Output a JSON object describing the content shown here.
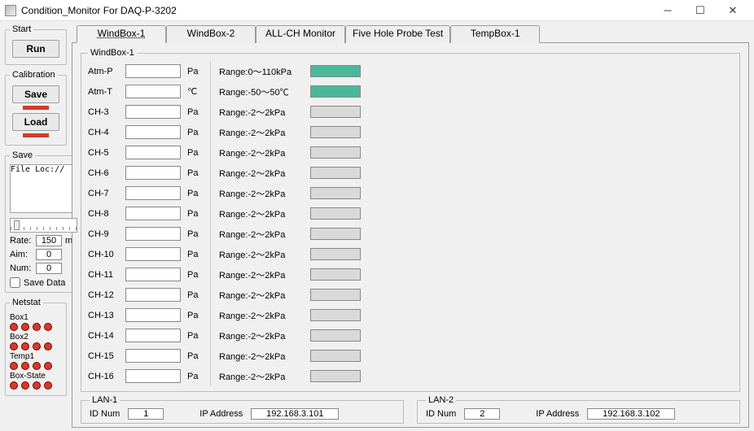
{
  "window": {
    "title": "Condition_Monitor For DAQ-P-3202"
  },
  "sidebar": {
    "start": {
      "legend": "Start",
      "run": "Run"
    },
    "calibration": {
      "legend": "Calibration",
      "save": "Save",
      "load": "Load"
    },
    "save": {
      "legend": "Save",
      "file_loc_text": "File Loc://",
      "rate_label": "Rate:",
      "rate_value": "150",
      "rate_unit": "ms",
      "aim_label": "Aim:",
      "aim_value": "0",
      "num_label": "Num:",
      "num_value": "0",
      "save_data_label": "Save Data"
    },
    "netstat": {
      "legend": "Netstat",
      "rows": [
        {
          "label": "Box1",
          "count": 4
        },
        {
          "label": "Box2",
          "count": 4
        },
        {
          "label": "Temp1",
          "count": 4
        },
        {
          "label": "Box-State",
          "count": 4
        }
      ]
    }
  },
  "tabs": [
    {
      "label": "WindBox-1"
    },
    {
      "label": "WindBox-2"
    },
    {
      "label": "ALL-CH Monitor"
    },
    {
      "label": "Five Hole Probe Test"
    },
    {
      "label": "TempBox-1"
    }
  ],
  "active_tab": 0,
  "windbox": {
    "legend": "WindBox-1",
    "channels": [
      {
        "name": "Atm-P",
        "value": "",
        "unit": "Pa",
        "range": "Range:0～110kPa",
        "green": true
      },
      {
        "name": "Atm-T",
        "value": "",
        "unit": "℃",
        "range": "Range:-50～50℃",
        "green": true
      },
      {
        "name": "CH-3",
        "value": "",
        "unit": "Pa",
        "range": "Range:-2～2kPa",
        "green": false
      },
      {
        "name": "CH-4",
        "value": "",
        "unit": "Pa",
        "range": "Range:-2～2kPa",
        "green": false
      },
      {
        "name": "CH-5",
        "value": "",
        "unit": "Pa",
        "range": "Range:-2～2kPa",
        "green": false
      },
      {
        "name": "CH-6",
        "value": "",
        "unit": "Pa",
        "range": "Range:-2～2kPa",
        "green": false
      },
      {
        "name": "CH-7",
        "value": "",
        "unit": "Pa",
        "range": "Range:-2～2kPa",
        "green": false
      },
      {
        "name": "CH-8",
        "value": "",
        "unit": "Pa",
        "range": "Range:-2～2kPa",
        "green": false
      },
      {
        "name": "CH-9",
        "value": "",
        "unit": "Pa",
        "range": "Range:-2～2kPa",
        "green": false
      },
      {
        "name": "CH-10",
        "value": "",
        "unit": "Pa",
        "range": "Range:-2～2kPa",
        "green": false
      },
      {
        "name": "CH-11",
        "value": "",
        "unit": "Pa",
        "range": "Range:-2～2kPa",
        "green": false
      },
      {
        "name": "CH-12",
        "value": "",
        "unit": "Pa",
        "range": "Range:-2～2kPa",
        "green": false
      },
      {
        "name": "CH-13",
        "value": "",
        "unit": "Pa",
        "range": "Range:-2～2kPa",
        "green": false
      },
      {
        "name": "CH-14",
        "value": "",
        "unit": "Pa",
        "range": "Range:-2～2kPa",
        "green": false
      },
      {
        "name": "CH-15",
        "value": "",
        "unit": "Pa",
        "range": "Range:-2～2kPa",
        "green": false
      },
      {
        "name": "CH-16",
        "value": "",
        "unit": "Pa",
        "range": "Range:-2～2kPa",
        "green": false
      }
    ]
  },
  "lan": [
    {
      "legend": "LAN-1",
      "id_label": "ID Num",
      "id_value": "1",
      "ip_label": "IP Address",
      "ip_value": "192.168.3.101"
    },
    {
      "legend": "LAN-2",
      "id_label": "ID Num",
      "id_value": "2",
      "ip_label": "IP Address",
      "ip_value": "192.168.3.102"
    }
  ]
}
